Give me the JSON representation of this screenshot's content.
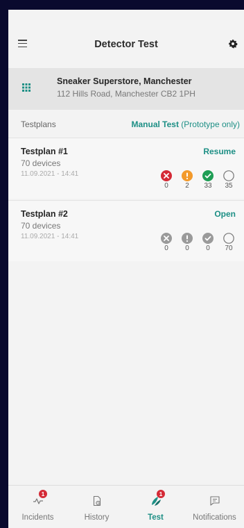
{
  "app": {
    "title": "Detector Test"
  },
  "location": {
    "name": "Sneaker Superstore, Manchester",
    "address": "112 Hills Road, Manchester CB2 1PH"
  },
  "section": {
    "label": "Testplans",
    "link_bold": "Manual Test",
    "link_rest": " (Prototype only)"
  },
  "testplans": [
    {
      "name": "Testplan #1",
      "devices": "70 devices",
      "date": "11.09.2021 - 14:41",
      "action": "Resume",
      "counts": [
        "0",
        "2",
        "33",
        "35"
      ]
    },
    {
      "name": "Testplan #2",
      "devices": "70 devices",
      "date": "11.09.2021 - 14:41",
      "action": "Open",
      "counts": [
        "0",
        "0",
        "0",
        "70"
      ]
    }
  ],
  "tabs": [
    {
      "label": "Incidents",
      "icon": "pulse-icon",
      "badge": "1"
    },
    {
      "label": "History",
      "icon": "history-icon"
    },
    {
      "label": "Test",
      "icon": "test-icon",
      "badge": "1",
      "active": true
    },
    {
      "label": "Notifications",
      "icon": "message-icon"
    }
  ],
  "colors": {
    "accent": "#1d8f85",
    "failed": "#d42a36",
    "warning": "#f39a2b",
    "passed": "#1f9e55",
    "inactive": "#9a9a9a"
  }
}
